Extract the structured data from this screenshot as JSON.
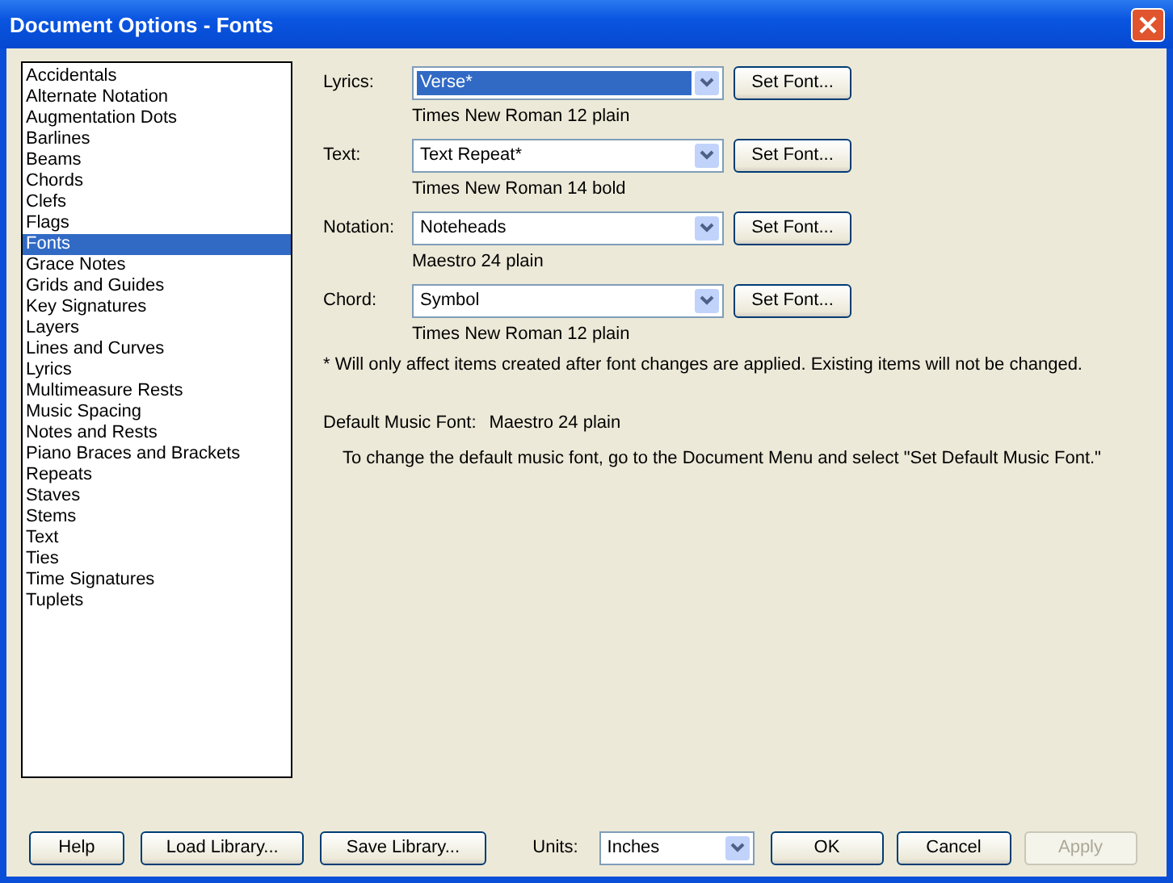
{
  "window": {
    "title": "Document Options - Fonts"
  },
  "categories": [
    {
      "label": "Accidentals",
      "selected": false
    },
    {
      "label": "Alternate Notation",
      "selected": false
    },
    {
      "label": "Augmentation Dots",
      "selected": false
    },
    {
      "label": "Barlines",
      "selected": false
    },
    {
      "label": "Beams",
      "selected": false
    },
    {
      "label": "Chords",
      "selected": false
    },
    {
      "label": "Clefs",
      "selected": false
    },
    {
      "label": "Flags",
      "selected": false
    },
    {
      "label": "Fonts",
      "selected": true
    },
    {
      "label": "Grace Notes",
      "selected": false
    },
    {
      "label": "Grids and Guides",
      "selected": false
    },
    {
      "label": "Key Signatures",
      "selected": false
    },
    {
      "label": "Layers",
      "selected": false
    },
    {
      "label": "Lines and Curves",
      "selected": false
    },
    {
      "label": "Lyrics",
      "selected": false
    },
    {
      "label": "Multimeasure Rests",
      "selected": false
    },
    {
      "label": "Music Spacing",
      "selected": false
    },
    {
      "label": "Notes and Rests",
      "selected": false
    },
    {
      "label": "Piano Braces and Brackets",
      "selected": false
    },
    {
      "label": "Repeats",
      "selected": false
    },
    {
      "label": "Staves",
      "selected": false
    },
    {
      "label": "Stems",
      "selected": false
    },
    {
      "label": "Text",
      "selected": false
    },
    {
      "label": "Ties",
      "selected": false
    },
    {
      "label": "Time Signatures",
      "selected": false
    },
    {
      "label": "Tuplets",
      "selected": false
    }
  ],
  "font_rows": [
    {
      "label": "Lyrics:",
      "value": "Verse*",
      "selected": true,
      "button": "Set Font...",
      "font": "Times New Roman 12 plain"
    },
    {
      "label": "Text:",
      "value": "Text Repeat*",
      "selected": false,
      "button": "Set Font...",
      "font": "Times New Roman 14 bold"
    },
    {
      "label": "Notation:",
      "value": "Noteheads",
      "selected": false,
      "button": "Set Font...",
      "font": "Maestro 24 plain"
    },
    {
      "label": "Chord:",
      "value": "Symbol",
      "selected": false,
      "button": "Set Font...",
      "font": "Times New Roman 12 plain"
    }
  ],
  "footnote": "* Will only affect items created after font changes are applied.  Existing items will not be changed.",
  "default_font": {
    "label": "Default Music Font:",
    "value": "Maestro 24 plain"
  },
  "instruction": "To change the default music font, go to the Document Menu and select \"Set Default Music Font.\"",
  "footer": {
    "left_buttons": [
      {
        "label": "Help",
        "disabled": false
      },
      {
        "label": "Load Library...",
        "disabled": false
      },
      {
        "label": "Save Library...",
        "disabled": false
      }
    ],
    "units_label": "Units:",
    "units_value": "Inches",
    "right_buttons": [
      {
        "label": "OK",
        "disabled": false
      },
      {
        "label": "Cancel",
        "disabled": false
      },
      {
        "label": "Apply",
        "disabled": true
      }
    ]
  }
}
